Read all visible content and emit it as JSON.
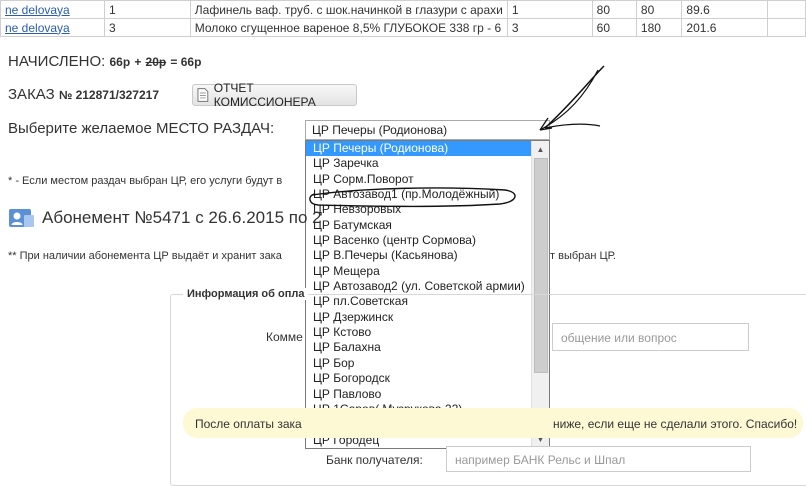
{
  "orders": {
    "rows": [
      {
        "user": "ne delovaya",
        "qty": "1",
        "name": "Лафинель ваф. труб. с шок.начинкой в глазури с арахи",
        "col4": "1",
        "col5": "80",
        "col6": "80",
        "col7": "89.6"
      },
      {
        "user": "ne delovaya",
        "qty": "3",
        "name": "Молоко сгущенное вареное 8,5% ГЛУБОКОЕ 338 гр - 6",
        "col4": "3",
        "col5": "60",
        "col6": "180",
        "col7": "201.6"
      }
    ]
  },
  "charged": {
    "label": "НАЧИСЛЕНО:",
    "value1": "66р",
    "plus": "+",
    "struck": "20р",
    "eq": "= 66р"
  },
  "order": {
    "label": "ЗАКАЗ",
    "number": "№ 212871/327217",
    "report_button": "ОТЧЕТ КОМИССИОНЕРА"
  },
  "place": {
    "label": "Выберите желаемое МЕСТО РАЗДАЧ:",
    "selected": "ЦР Печеры (Родионова)",
    "options": [
      "ЦР Печеры (Родионова)",
      "ЦР Заречка",
      "ЦР Сорм.Поворот",
      "ЦР Автозавод1 (пр.Молодёжный)",
      "ЦР Невзоровых",
      "ЦР Батумская",
      "ЦР Васенко (центр Сормова)",
      "ЦР В.Печеры (Касьянова)",
      "ЦР Мещера",
      "ЦР Автозавод2 (ул. Советской армии)",
      "ЦР пл.Советская",
      "ЦР Дзержинск",
      "ЦР Кстово",
      "ЦР Балахна",
      "ЦР Бор",
      "ЦР Богородск",
      "ЦР Павлово",
      "ЦР 1Саров( Музрукова 22)",
      "ЦР Арзамас",
      "ЦР Городец"
    ]
  },
  "notes": {
    "note1": "* - Если местом раздач выбран ЦР, его услуги будут в",
    "subscription": "Абонемент №5471 с 26.6.2015 по 2",
    "note2": "** При наличии абонемента ЦР выдаёт и хранит зака",
    "note2_tail": "т выбран ЦР."
  },
  "payment": {
    "legend": "Информация об опла",
    "comment_label": "Комме",
    "comment_placeholder": "общение или вопрос",
    "yellow_left": "После оплаты зака",
    "yellow_right": "ниже, если еще не сделали этого. Спасибо!",
    "bank_label": "Банк получателя:",
    "bank_placeholder": "например БАНК Рельс и Шпал"
  },
  "colors": {
    "selection": "#3399ff",
    "link": "#2a5db0",
    "notice_bg": "#fdf9d5"
  }
}
